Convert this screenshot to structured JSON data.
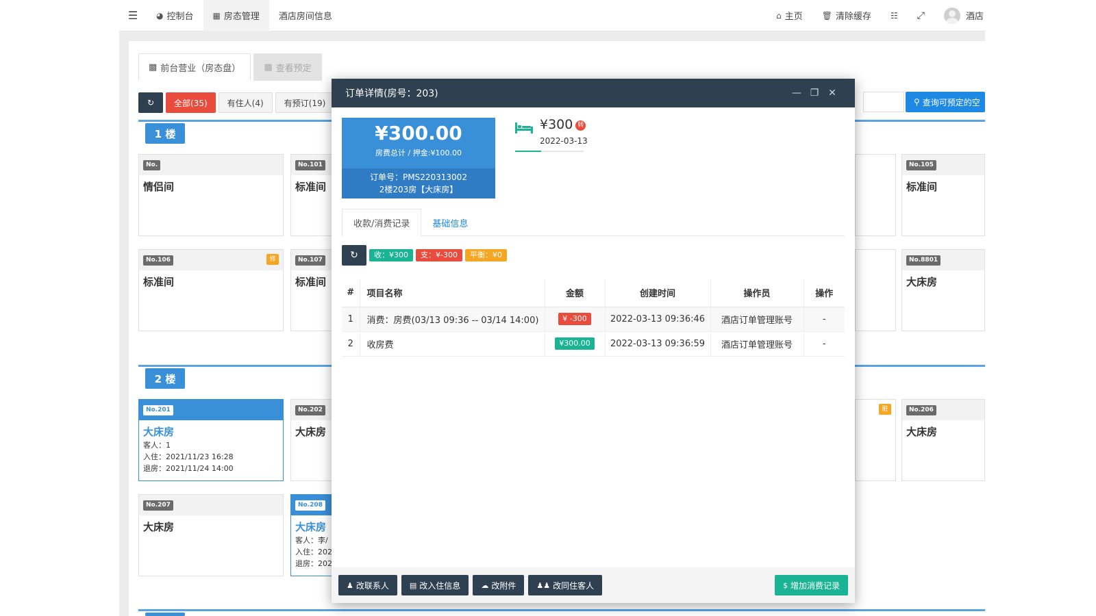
{
  "topbar": {
    "menu_icon": "menu-icon",
    "nav": [
      {
        "label": "控制台",
        "icon": "dashboard-icon"
      },
      {
        "label": "房态管理",
        "icon": "calendar-icon"
      },
      {
        "label": "酒店房间信息"
      }
    ],
    "home_label": "主页",
    "clear_cache_label": "清除缓存",
    "user_label": "酒店"
  },
  "page": {
    "tabs": [
      "前台营业（房态盘）",
      "查看预定"
    ],
    "filters": {
      "all": "全部(35)",
      "occupied": "有住人(4)",
      "reserved": "有预订(19)"
    },
    "search_button": "查询可预定的空"
  },
  "floors": [
    {
      "label": "1 楼"
    },
    {
      "label": "2 楼"
    }
  ],
  "rooms": [
    {
      "no": "No.",
      "type": "情侣间"
    },
    {
      "no": "No.101",
      "type": "标准间"
    },
    {
      "no": "No.105",
      "type": "标准间"
    },
    {
      "no": "No.106",
      "type": "标准间",
      "badge": "修"
    },
    {
      "no": "No.107",
      "type": "标准间"
    },
    {
      "no": "No.8801",
      "type": "大床房"
    },
    {
      "no": "No.201",
      "type": "大床房",
      "guests": "客人：1",
      "checkin": "入住：2021/11/23 16:28",
      "checkout": "退房：2021/11/24 14:00"
    },
    {
      "no": "No.202",
      "type": "大床房"
    },
    {
      "badge": "脏"
    },
    {
      "no": "No.206",
      "type": "大床房"
    },
    {
      "no": "No.207",
      "type": "大床房"
    },
    {
      "no": "No.208",
      "type": "大床房",
      "guests": "客人：李/",
      "checkin": "入住：202",
      "checkout": "退房：202"
    }
  ],
  "modal": {
    "title": "订单详情(房号：203)",
    "price_total": "¥300.00",
    "price_sub": "房费总计 / 押金:¥100.00",
    "order_no": "订单号：PMS220313002",
    "room_desc": "2楼203房【大床房】",
    "day_price": "¥300",
    "day_badge": "转",
    "day_date": "2022-03-13",
    "tabs": [
      "收款/消费记录",
      "基础信息"
    ],
    "summary": {
      "income": "收：¥300",
      "expense": "支：¥-300",
      "balance": "平衡：¥0"
    },
    "table": {
      "headers": [
        "#",
        "项目名称",
        "金额",
        "创建时间",
        "操作员",
        "操作"
      ],
      "rows": [
        {
          "no": "1",
          "name": "消费：房费(03/13 09:36 -- 03/14 14:00)",
          "amount": "¥ -300",
          "time": "2022-03-13 09:36:46",
          "operator": "酒店订单管理账号",
          "action": "-"
        },
        {
          "no": "2",
          "name": "收房费",
          "amount": "¥300.00",
          "time": "2022-03-13 09:36:59",
          "operator": "酒店订单管理账号",
          "action": "-"
        }
      ]
    },
    "footer": {
      "edit_contact": "改联系人",
      "edit_checkin": "改入住信息",
      "edit_attachment": "改附件",
      "edit_guests": "改同住客人",
      "add_consumption": "增加消费记录"
    }
  },
  "colors": {
    "accent": "#3a8fd9",
    "dark": "#2f4050",
    "green": "#1ab394",
    "red": "#e94b3c",
    "orange": "#f5a623"
  }
}
